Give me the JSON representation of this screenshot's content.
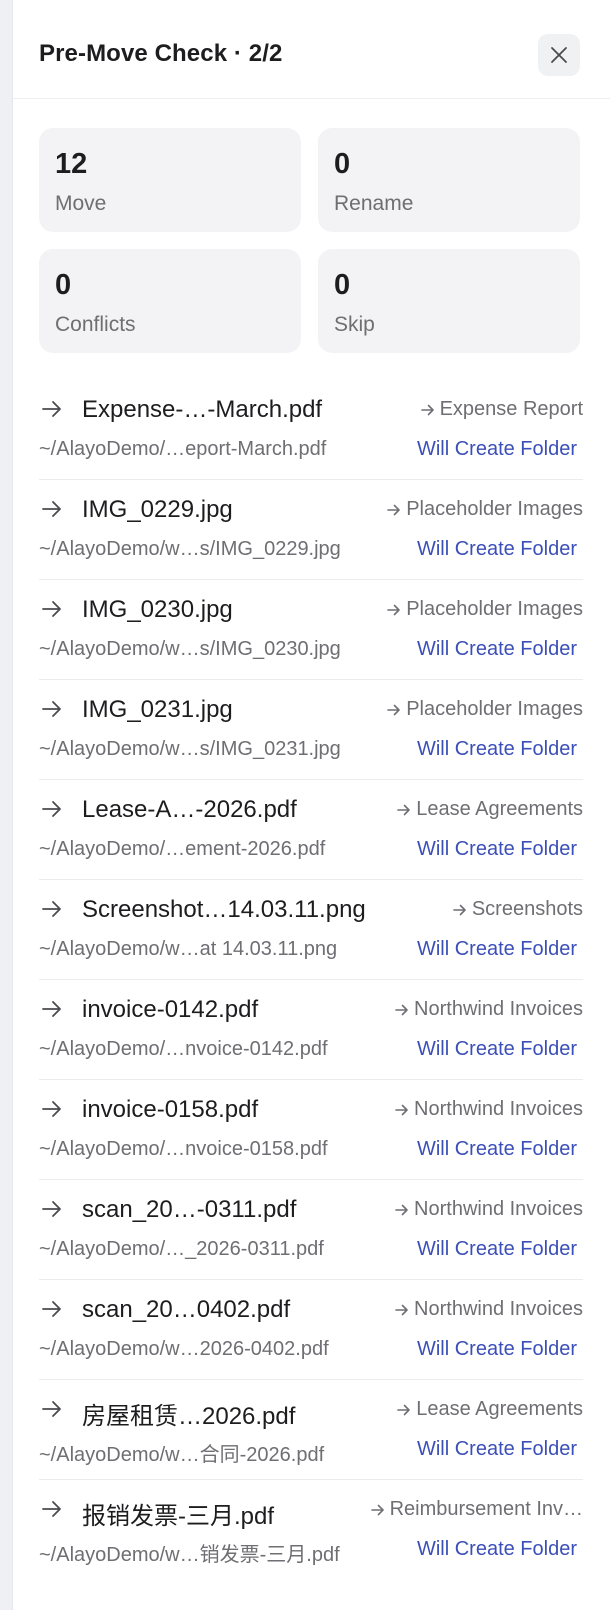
{
  "header": {
    "title": "Pre-Move Check · 2/2"
  },
  "stats": [
    {
      "value": "12",
      "label": "Move"
    },
    {
      "value": "0",
      "label": "Rename"
    },
    {
      "value": "0",
      "label": "Conflicts"
    },
    {
      "value": "0",
      "label": "Skip"
    }
  ],
  "items": [
    {
      "name": "Expense-…-March.pdf",
      "dest": "Expense Report",
      "path": "~/AlayoDemo/…eport-March.pdf",
      "badge": "Will Create Folder"
    },
    {
      "name": "IMG_0229.jpg",
      "dest": "Placeholder Images",
      "path": "~/AlayoDemo/w…s/IMG_0229.jpg",
      "badge": "Will Create Folder"
    },
    {
      "name": "IMG_0230.jpg",
      "dest": "Placeholder Images",
      "path": "~/AlayoDemo/w…s/IMG_0230.jpg",
      "badge": "Will Create Folder"
    },
    {
      "name": "IMG_0231.jpg",
      "dest": "Placeholder Images",
      "path": "~/AlayoDemo/w…s/IMG_0231.jpg",
      "badge": "Will Create Folder"
    },
    {
      "name": "Lease-A…-2026.pdf",
      "dest": "Lease Agreements",
      "path": "~/AlayoDemo/…ement-2026.pdf",
      "badge": "Will Create Folder"
    },
    {
      "name": "Screenshot…14.03.11.png",
      "dest": "Screenshots",
      "path": "~/AlayoDemo/w…at 14.03.11.png",
      "badge": "Will Create Folder"
    },
    {
      "name": "invoice-0142.pdf",
      "dest": "Northwind Invoices",
      "path": "~/AlayoDemo/…nvoice-0142.pdf",
      "badge": "Will Create Folder"
    },
    {
      "name": "invoice-0158.pdf",
      "dest": "Northwind Invoices",
      "path": "~/AlayoDemo/…nvoice-0158.pdf",
      "badge": "Will Create Folder"
    },
    {
      "name": "scan_20…-0311.pdf",
      "dest": "Northwind Invoices",
      "path": "~/AlayoDemo/…_2026-0311.pdf",
      "badge": "Will Create Folder"
    },
    {
      "name": "scan_20…0402.pdf",
      "dest": "Northwind Invoices",
      "path": "~/AlayoDemo/w…2026-0402.pdf",
      "badge": "Will Create Folder"
    },
    {
      "name": "房屋租赁…2026.pdf",
      "dest": "Lease Agreements",
      "path": "~/AlayoDemo/w…合同-2026.pdf",
      "badge": "Will Create Folder"
    },
    {
      "name": "报销发票-三月.pdf",
      "dest": "Reimbursement Inv…",
      "path": "~/AlayoDemo/w…销发票-三月.pdf",
      "badge": "Will Create Folder"
    }
  ]
}
